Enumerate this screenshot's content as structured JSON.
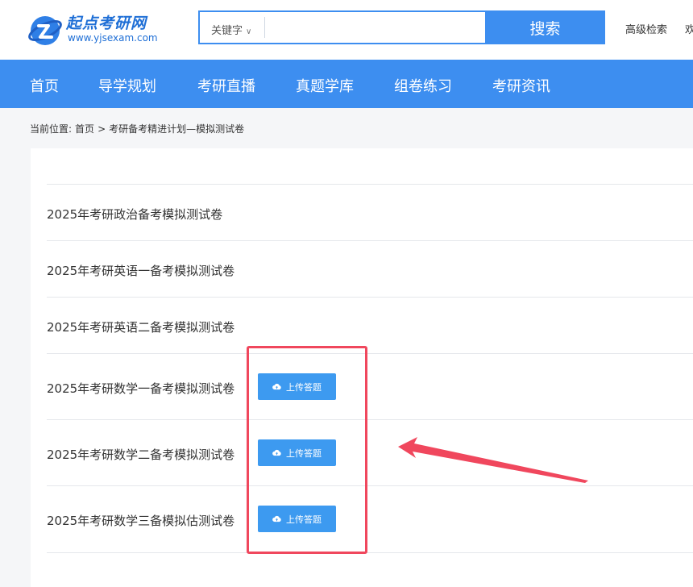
{
  "header": {
    "logo_title": "起点考研网",
    "logo_url": "www.yjsexam.com",
    "search": {
      "keyword_select": "关键字",
      "placeholder": "",
      "button_label": "搜索"
    },
    "advanced_search": "高级检索",
    "welcome_partial": "欢"
  },
  "nav": {
    "items": [
      "首页",
      "导学规划",
      "考研直播",
      "真题学库",
      "组卷练习",
      "考研资讯"
    ]
  },
  "breadcrumb": {
    "prefix": "当前位置:",
    "home": "首页",
    "separator": ">",
    "current": "考研备考精进计划—模拟测试卷"
  },
  "papers": [
    {
      "title": "2025年考研政治备考模拟测试卷",
      "upload_label": ""
    },
    {
      "title": "2025年考研英语一备考模拟测试卷",
      "upload_label": ""
    },
    {
      "title": "2025年考研英语二备考模拟测试卷",
      "upload_label": ""
    },
    {
      "title": "2025年考研数学一备考模拟测试卷",
      "upload_label": "上传答题"
    },
    {
      "title": "2025年考研数学二备考模拟测试卷",
      "upload_label": "上传答题"
    },
    {
      "title": "2025年考研数学三备模拟估测试卷",
      "upload_label": "上传答题"
    }
  ],
  "colors": {
    "primary": "#3d8ef0",
    "button": "#3d9af0",
    "annotation": "#f0475d"
  }
}
